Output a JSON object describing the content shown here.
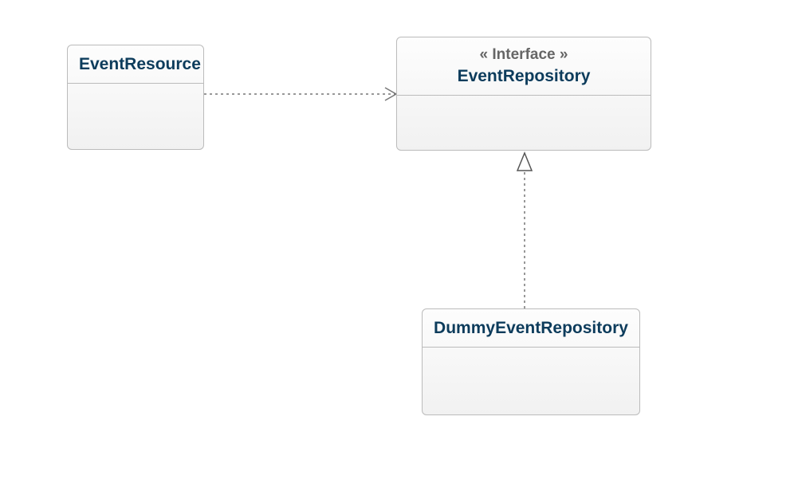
{
  "classes": {
    "eventResource": {
      "name": "EventResource"
    },
    "eventRepository": {
      "stereotype": "« Interface »",
      "name": "EventRepository"
    },
    "dummyEventRepository": {
      "name": "DummyEventRepository"
    }
  },
  "relationships": [
    {
      "from": "EventResource",
      "to": "EventRepository",
      "type": "dependency"
    },
    {
      "from": "DummyEventRepository",
      "to": "EventRepository",
      "type": "realization"
    }
  ]
}
